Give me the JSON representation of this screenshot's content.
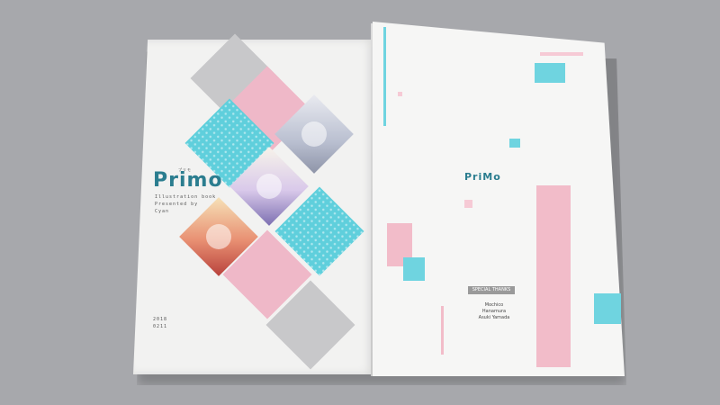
{
  "back_cover": {
    "logo": "Primo",
    "logo_ruby": "プリモ",
    "subtitle_1": "Illustration book",
    "subtitle_2": "Presented by",
    "subtitle_3": "Cyan",
    "date_1": "2018",
    "date_2": "0211"
  },
  "front_cover": {
    "logo": "PriMo",
    "badge": "SPECIAL THANKS",
    "credit_1": "Mochico",
    "credit_2": "Hanamura",
    "credit_3": "Asuki Yamada"
  },
  "colors": {
    "cyan": "#5fcfdc",
    "pink": "#efb8c8",
    "gray": "#c8c8ca",
    "table": "#a7a8ac"
  }
}
